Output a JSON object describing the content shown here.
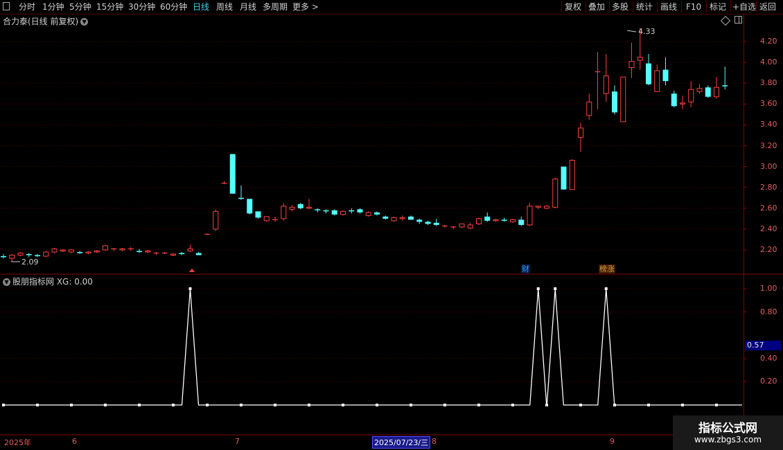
{
  "toolbar": {
    "periods": [
      "分时",
      "1分钟",
      "5分钟",
      "15分钟",
      "30分钟",
      "60分钟",
      "日线",
      "周线",
      "月线",
      "多周期",
      "更多 >"
    ],
    "active_period": "日线",
    "right_buttons": [
      "复权",
      "叠加",
      "多股",
      "统计",
      "画线",
      "F10",
      "标记",
      "+自选",
      "返回"
    ]
  },
  "chart": {
    "title": "合力泰(日线 前复权)",
    "y_ticks": [
      "4.20",
      "4.00",
      "3.80",
      "3.60",
      "3.40",
      "3.20",
      "3.00",
      "2.80",
      "2.60",
      "2.40",
      "2.20"
    ],
    "high_label": "4.33",
    "low_label": "2.09",
    "badges": [
      {
        "text": "财",
        "color": "#3aa0ff",
        "bg": "#001a40"
      },
      {
        "text": "榜涨",
        "color": "#e0a040",
        "bg": "#3a1a00"
      }
    ],
    "up_color": "#ff4040",
    "down_color": "#54ffff"
  },
  "indicator": {
    "title": "股朋指标网 XG: 0.00",
    "y_ticks": [
      "1.00",
      "0.80",
      "0.40",
      "0.20"
    ],
    "current_value": "0.57"
  },
  "date_axis": {
    "labels": [
      "2025年",
      "6",
      "7",
      "8",
      "9"
    ],
    "highlight": "2025/07/23/三"
  },
  "watermark": {
    "line1": "指标公式网",
    "line2": "www.zbgs3.com"
  },
  "chart_data": {
    "type": "candlestick",
    "ylim": [
      2.05,
      4.38
    ],
    "candles": [
      [
        2.14,
        2.16,
        2.12,
        2.13
      ],
      [
        2.12,
        2.16,
        2.09,
        2.15
      ],
      [
        2.15,
        2.18,
        2.14,
        2.17
      ],
      [
        2.16,
        2.17,
        2.13,
        2.15
      ],
      [
        2.15,
        2.16,
        2.13,
        2.14
      ],
      [
        2.14,
        2.19,
        2.13,
        2.18
      ],
      [
        2.18,
        2.22,
        2.17,
        2.21
      ],
      [
        2.19,
        2.21,
        2.18,
        2.2
      ],
      [
        2.18,
        2.21,
        2.17,
        2.2
      ],
      [
        2.18,
        2.19,
        2.16,
        2.17
      ],
      [
        2.17,
        2.19,
        2.16,
        2.18
      ],
      [
        2.18,
        2.2,
        2.17,
        2.19
      ],
      [
        2.2,
        2.25,
        2.19,
        2.24
      ],
      [
        2.21,
        2.22,
        2.19,
        2.21
      ],
      [
        2.2,
        2.22,
        2.19,
        2.21
      ],
      [
        2.21,
        2.23,
        2.19,
        2.21
      ],
      [
        2.19,
        2.21,
        2.17,
        2.18
      ],
      [
        2.18,
        2.2,
        2.17,
        2.19
      ],
      [
        2.17,
        2.18,
        2.15,
        2.17
      ],
      [
        2.17,
        2.18,
        2.16,
        2.17
      ],
      [
        2.15,
        2.17,
        2.14,
        2.16
      ],
      [
        2.17,
        2.18,
        2.15,
        2.16
      ],
      [
        2.19,
        2.25,
        2.18,
        2.21
      ],
      [
        2.17,
        2.18,
        2.15,
        2.15
      ],
      [
        2.35,
        2.36,
        2.35,
        2.35
      ],
      [
        2.4,
        2.59,
        2.38,
        2.57
      ],
      [
        2.84,
        2.86,
        2.83,
        2.84
      ],
      [
        3.12,
        3.12,
        2.74,
        2.74
      ],
      [
        2.7,
        2.82,
        2.68,
        2.69
      ],
      [
        2.69,
        2.69,
        2.54,
        2.55
      ],
      [
        2.57,
        2.57,
        2.5,
        2.51
      ],
      [
        2.48,
        2.52,
        2.47,
        2.52
      ],
      [
        2.49,
        2.52,
        2.47,
        2.49
      ],
      [
        2.5,
        2.65,
        2.48,
        2.62
      ],
      [
        2.59,
        2.63,
        2.57,
        2.61
      ],
      [
        2.64,
        2.65,
        2.59,
        2.6
      ],
      [
        2.6,
        2.69,
        2.59,
        2.61
      ],
      [
        2.59,
        2.6,
        2.56,
        2.58
      ],
      [
        2.58,
        2.59,
        2.55,
        2.57
      ],
      [
        2.58,
        2.59,
        2.53,
        2.54
      ],
      [
        2.54,
        2.58,
        2.53,
        2.57
      ],
      [
        2.58,
        2.6,
        2.55,
        2.57
      ],
      [
        2.59,
        2.6,
        2.55,
        2.56
      ],
      [
        2.53,
        2.57,
        2.52,
        2.56
      ],
      [
        2.56,
        2.57,
        2.53,
        2.54
      ],
      [
        2.52,
        2.53,
        2.49,
        2.5
      ],
      [
        2.48,
        2.52,
        2.47,
        2.51
      ],
      [
        2.5,
        2.53,
        2.48,
        2.51
      ],
      [
        2.52,
        2.53,
        2.49,
        2.49
      ],
      [
        2.49,
        2.5,
        2.45,
        2.47
      ],
      [
        2.47,
        2.48,
        2.44,
        2.45
      ],
      [
        2.46,
        2.5,
        2.43,
        2.44
      ],
      [
        2.43,
        2.44,
        2.41,
        2.43
      ],
      [
        2.42,
        2.43,
        2.4,
        2.42
      ],
      [
        2.42,
        2.45,
        2.41,
        2.45
      ],
      [
        2.41,
        2.46,
        2.4,
        2.44
      ],
      [
        2.45,
        2.51,
        2.44,
        2.5
      ],
      [
        2.52,
        2.56,
        2.47,
        2.48
      ],
      [
        2.48,
        2.5,
        2.47,
        2.49
      ],
      [
        2.49,
        2.51,
        2.47,
        2.48
      ],
      [
        2.47,
        2.5,
        2.46,
        2.49
      ],
      [
        2.49,
        2.52,
        2.43,
        2.44
      ],
      [
        2.44,
        2.65,
        2.43,
        2.62
      ],
      [
        2.61,
        2.62,
        2.59,
        2.62
      ],
      [
        2.6,
        2.63,
        2.59,
        2.62
      ],
      [
        2.61,
        2.89,
        2.6,
        2.88
      ],
      [
        3.0,
        3.0,
        2.78,
        2.78
      ],
      [
        2.78,
        3.07,
        2.78,
        3.06
      ],
      [
        3.28,
        3.42,
        3.14,
        3.37
      ],
      [
        3.49,
        3.7,
        3.45,
        3.62
      ],
      [
        3.91,
        4.1,
        3.55,
        3.91
      ],
      [
        3.7,
        4.08,
        3.62,
        3.87
      ],
      [
        3.72,
        3.78,
        3.5,
        3.52
      ],
      [
        3.43,
        3.86,
        3.43,
        3.86
      ],
      [
        3.95,
        4.19,
        3.85,
        4.01
      ],
      [
        4.02,
        4.33,
        3.93,
        4.05
      ],
      [
        3.99,
        4.08,
        3.78,
        3.79
      ],
      [
        3.72,
        3.98,
        3.72,
        3.92
      ],
      [
        3.93,
        4.05,
        3.78,
        3.82
      ],
      [
        3.7,
        3.73,
        3.57,
        3.58
      ],
      [
        3.6,
        3.68,
        3.55,
        3.61
      ],
      [
        3.62,
        3.82,
        3.57,
        3.74
      ],
      [
        3.72,
        3.79,
        3.7,
        3.75
      ],
      [
        3.76,
        3.78,
        3.66,
        3.67
      ],
      [
        3.67,
        3.86,
        3.65,
        3.76
      ],
      [
        3.78,
        3.96,
        3.74,
        3.77
      ]
    ],
    "signal_candles": [
      22,
      63,
      65,
      71
    ]
  }
}
